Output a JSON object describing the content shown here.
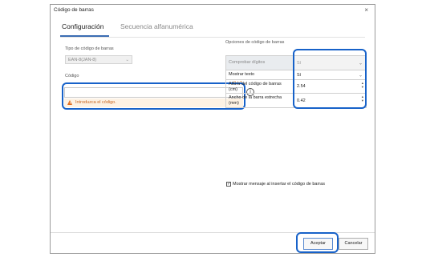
{
  "window": {
    "title": "Código de barras",
    "close_glyph": "×"
  },
  "tabs": [
    {
      "label": "Configuración",
      "active": true
    },
    {
      "label": "Secuencia alfanumérica",
      "active": false
    }
  ],
  "left": {
    "type_label": "Tipo de código de barras",
    "type_value": "EAN-8(JAN-8)",
    "code_label": "Código",
    "counter": "0 / 7",
    "code_value": "",
    "error_text": "Introduzca el código.",
    "info_icon": "info-icon"
  },
  "right": {
    "section_label": "Opciones de código de barras",
    "rows": [
      {
        "label": "Comprobar dígitos",
        "value": "Sí",
        "kind": "select",
        "disabled": true
      },
      {
        "label": "Mostrar texto",
        "value": "Sí",
        "kind": "select",
        "disabled": false
      },
      {
        "label": "Altura del código de barras (cm)",
        "value": "2.54",
        "kind": "spin",
        "disabled": false
      },
      {
        "label": "Ancho de la barra estrecha (mm)",
        "value": "0.42",
        "kind": "spin",
        "disabled": false
      }
    ],
    "checkbox_label": "Mostrar mensaje al insertar el código de barras",
    "checkbox_checked": true
  },
  "buttons": {
    "ok": "Aceptar",
    "cancel": "Cancelar"
  },
  "colors": {
    "accent": "#3b6db3",
    "highlight": "#1762c9",
    "error": "#c8641e",
    "error_bg": "#fdf2e4"
  }
}
